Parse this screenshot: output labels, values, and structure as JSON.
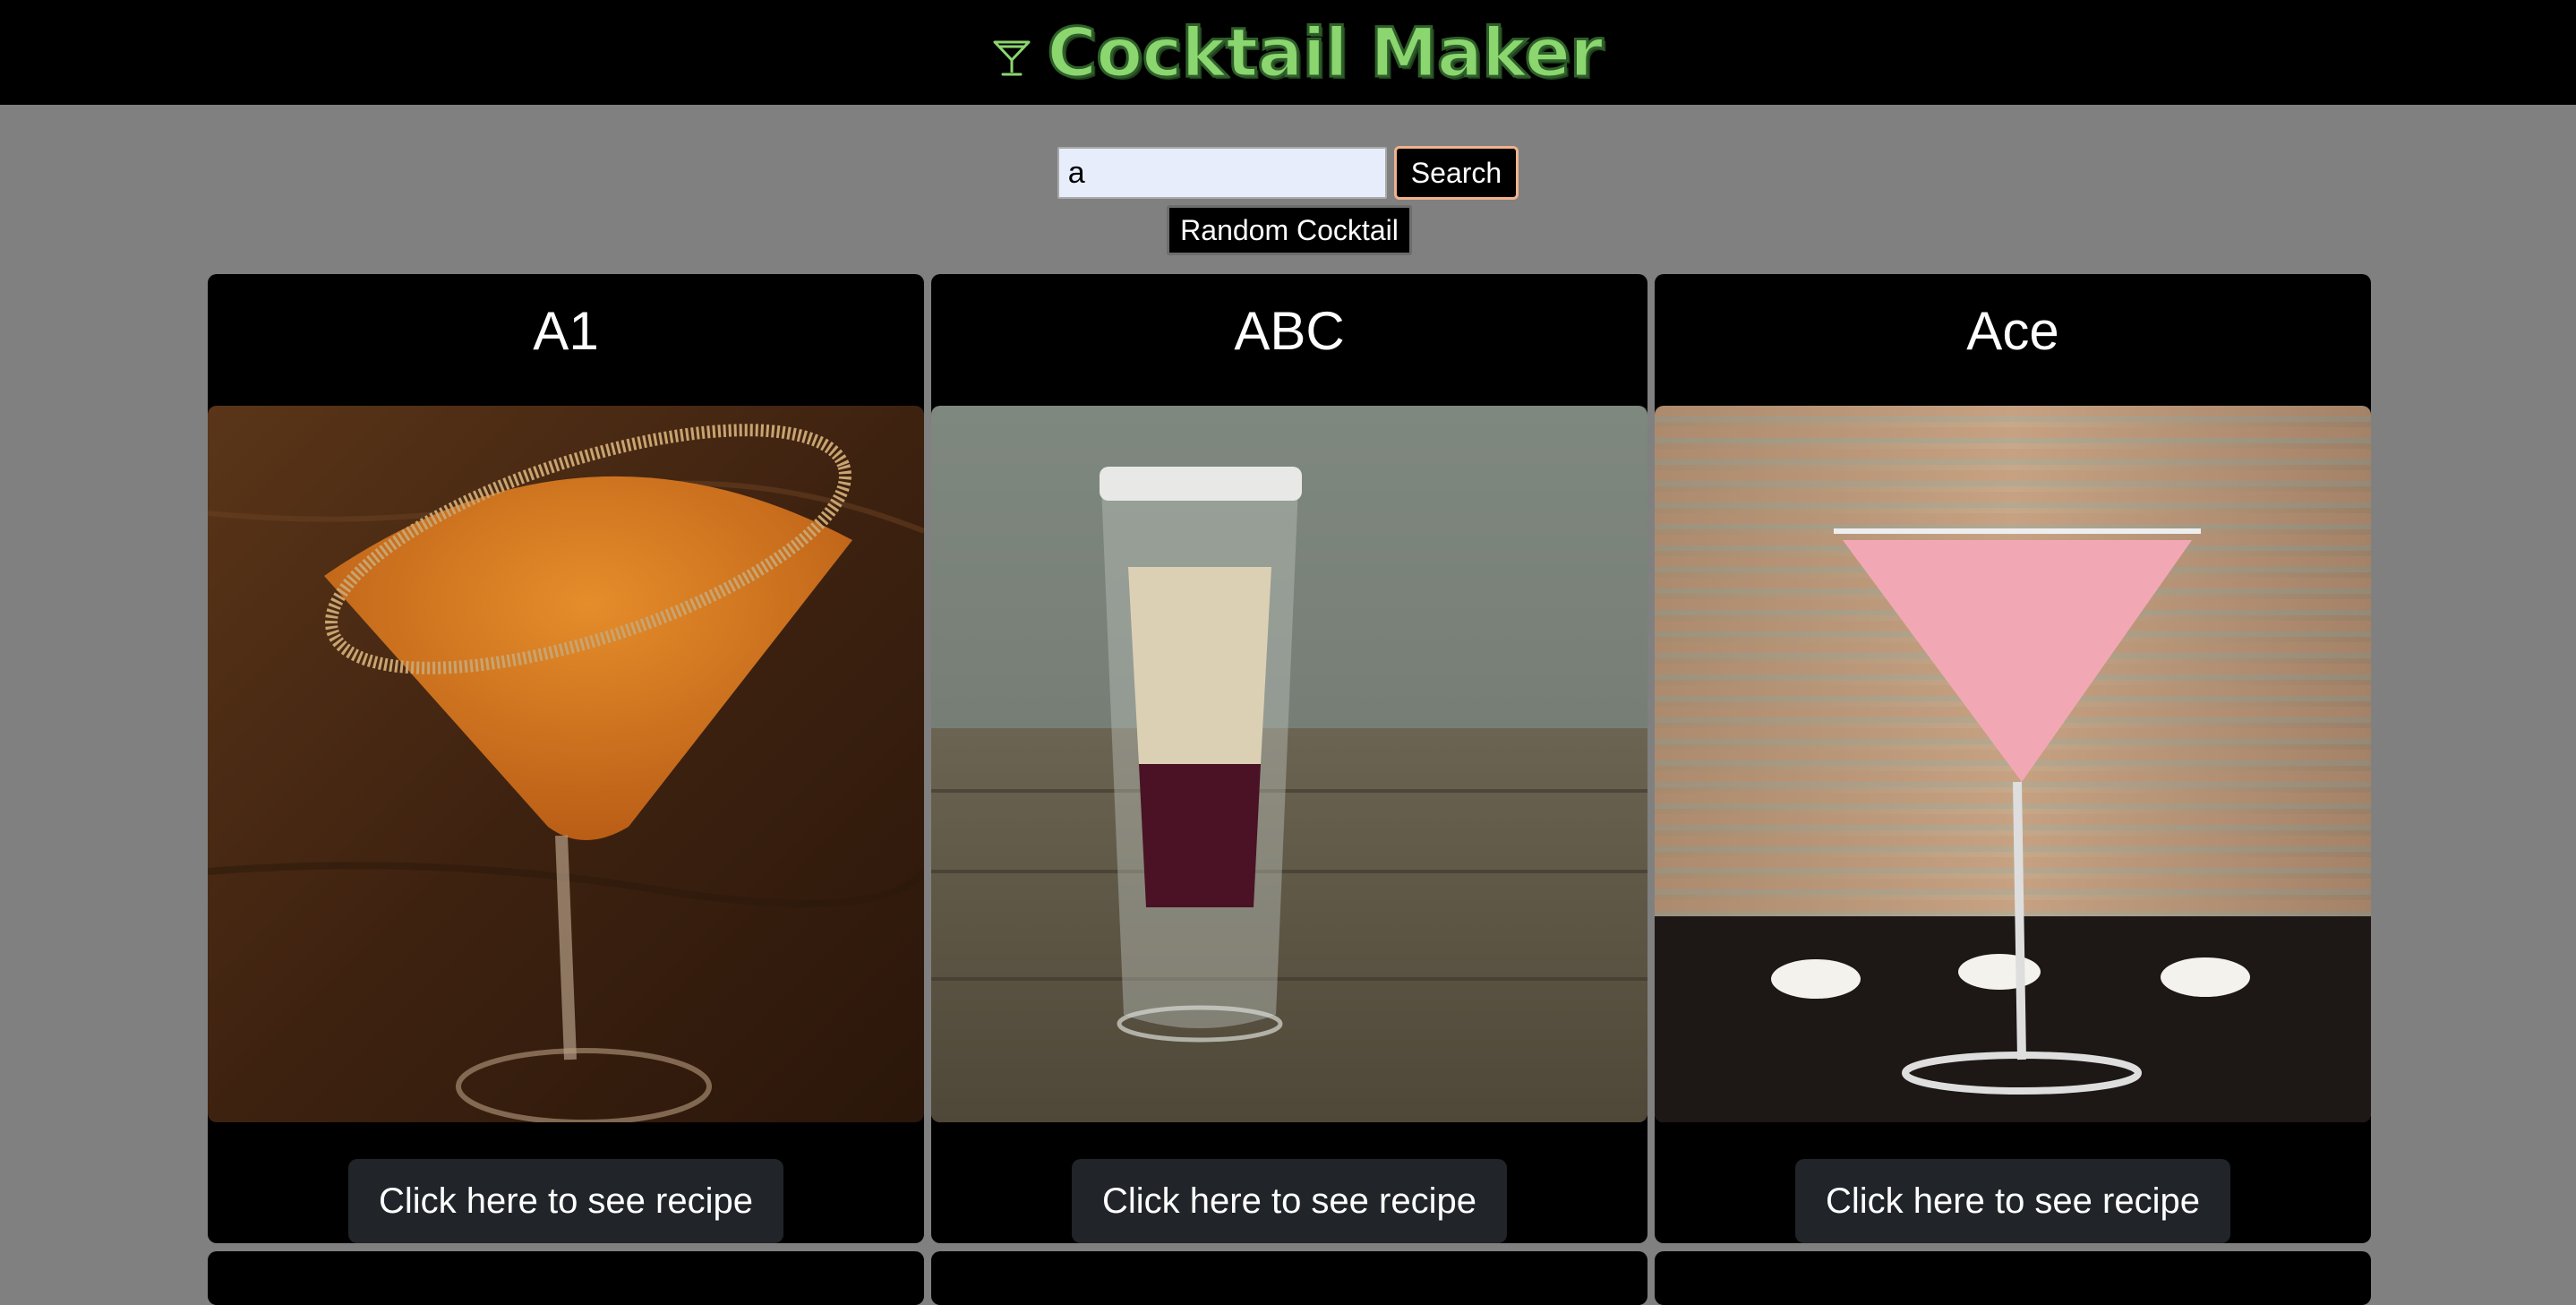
{
  "header": {
    "title": "Cocktail Maker",
    "logo_icon": "martini-glass-icon",
    "title_color": "#8bd66f"
  },
  "search": {
    "value": "a",
    "button_label": "Search"
  },
  "random_button_label": "Random Cocktail",
  "cards": [
    {
      "name": "A1",
      "button_label": "Click here to see recipe",
      "image": "orange-martini-sugar-rim"
    },
    {
      "name": "ABC",
      "button_label": "Click here to see recipe",
      "image": "layered-shot-glass"
    },
    {
      "name": "Ace",
      "button_label": "Click here to see recipe",
      "image": "pink-martini-candles"
    }
  ],
  "colors": {
    "page_background": "#808080",
    "header_background": "#000000",
    "card_background": "#000000",
    "recipe_button_background": "#212529",
    "search_button_border": "#f0b28c"
  }
}
